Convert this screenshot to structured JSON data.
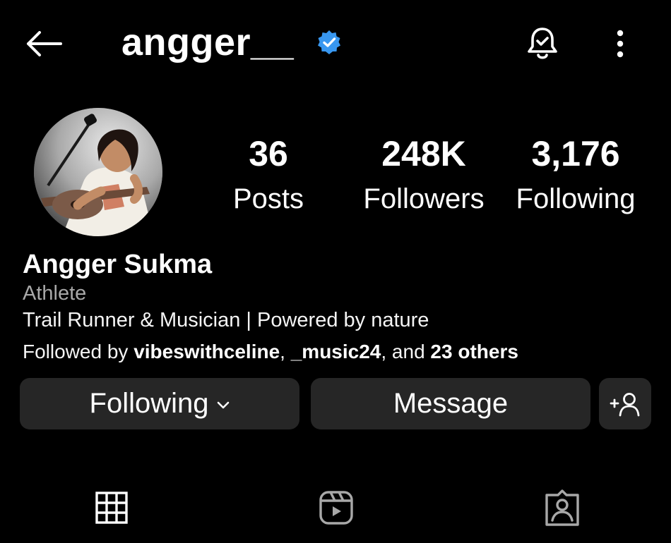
{
  "header": {
    "username": "angger__",
    "verified": true
  },
  "profile": {
    "display_name": "Angger Sukma",
    "category": "Athlete",
    "bio": "Trail Runner & Musician | Powered by nature",
    "followed_by": {
      "prefix": "Followed by ",
      "user1": "vibeswithceline",
      "sep1": ", ",
      "user2": "_music24",
      "sep2": ", and ",
      "others": "23 others"
    }
  },
  "stats": {
    "posts": {
      "value": "36",
      "label": "Posts"
    },
    "followers": {
      "value": "248K",
      "label": "Followers"
    },
    "following": {
      "value": "3,176",
      "label": "Following"
    }
  },
  "actions": {
    "following_label": "Following",
    "message_label": "Message"
  },
  "icons": {
    "back": "arrow-left-icon",
    "verified": "verified-badge-icon",
    "notifications": "bell-check-icon",
    "more": "more-vertical-icon",
    "suggest": "add-person-icon",
    "grid": "grid-icon",
    "reels": "reels-icon",
    "tagged": "tagged-icon"
  },
  "colors": {
    "background": "#000000",
    "button": "#262626",
    "verified": "#3897f0",
    "secondary_text": "#a8a8a8"
  }
}
